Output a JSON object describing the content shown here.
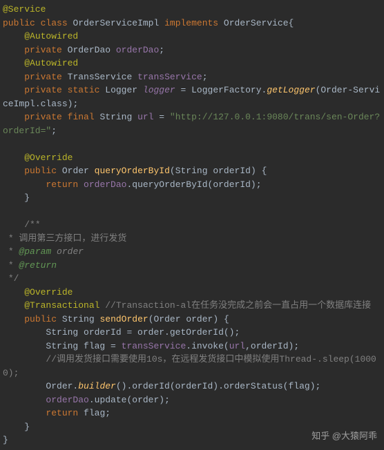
{
  "code": {
    "ann_service": "@Service",
    "kw_public1": "public",
    "kw_class": "class",
    "cls_impl": "OrderServiceImpl",
    "kw_implements": "implements",
    "cls_iface": "OrderService",
    "brace_open": "{",
    "ann_autowired1": "@Autowired",
    "kw_private1": "private",
    "type_orderdao": "OrderDao",
    "var_orderdao": "orderDao",
    "semi": ";",
    "ann_autowired2": "@Autowired",
    "kw_private2": "private",
    "type_trans": "TransService",
    "var_trans": "transService",
    "kw_private3": "private",
    "kw_static": "static",
    "type_logger": "Logger",
    "var_logger": "logger",
    "eq": " = ",
    "logger_cls": "LoggerFactory",
    "dot": ".",
    "fn_getlogger": "getLogger",
    "paren_open": "(",
    "arg_class": "Order‐ServiceImpl",
    "dot_class": ".class",
    "paren_close": ")",
    "kw_private4": "private",
    "kw_final": "final",
    "type_string": "String",
    "var_url": "url",
    "str_url": "\"http://127.0.0.1:9080/trans/sen‐Order?orderId=\"",
    "ann_override1": "@Override",
    "kw_public2": "public",
    "type_order": "Order",
    "fn_query": "queryOrderById",
    "param_string": "String",
    "param_orderid": "orderId",
    "kw_return1": "return",
    "call_query": "queryOrderById",
    "cmt_open": "/**",
    "cmt_line1": " * 调用第三方接口，进行发货",
    "cmt_line2_star": " * ",
    "cmt_param": "@param",
    "cmt_param_name": "order",
    "cmt_line3_star": " * ",
    "cmt_return": "@return",
    "cmt_close": " */",
    "ann_override2": "@Override",
    "ann_transactional": "@Transactional",
    "cmt_trans1": "//Transaction‐al在任务没完成之前会一直占用一个数据库连接",
    "kw_public3": "public",
    "fn_send": "sendOrder",
    "param_order_t": "Order",
    "param_order_n": "order",
    "stmt_oid": "String orderId = order.getOrderId();",
    "stmt_flag_a": "String flag = ",
    "stmt_flag_call": "invoke",
    "stmt_flag_args_url": "url",
    "stmt_flag_args_comma": ",",
    "stmt_flag_args_oid": "orderId",
    "cmt_sleep": "//调用发货接口需要使用10s，在远程发货接口中模拟使用Thread‐.sleep(10000);",
    "builder_a": "Order.",
    "builder_b": "builder",
    "builder_c": "().orderId(orderId).orderStatus(flag);",
    "update_a": ".update(",
    "update_b": "order",
    "kw_return2": "return",
    "ret_flag": "flag",
    "brace_close1": "}",
    "brace_close2": "}",
    "brace_close3": "}"
  },
  "watermark": "知乎 @大猿阿乖"
}
